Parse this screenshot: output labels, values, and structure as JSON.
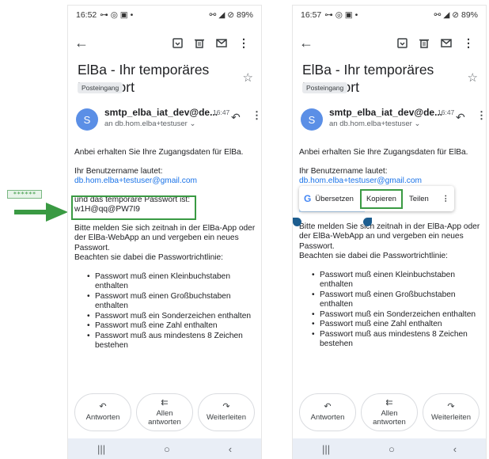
{
  "phones": [
    {
      "status_time": "16:52",
      "status_right": "89%",
      "subject": "ElBa - Ihr temporäres Passwort",
      "label": "Posteingang",
      "avatar_letter": "S",
      "sender": "smtp_elba_iat_dev@de...",
      "time": "16:47",
      "recipient": "an db.hom.elba+testuser ⌄"
    },
    {
      "status_time": "16:57",
      "status_right": "89%",
      "subject": "ElBa - Ihr temporäres Passwort",
      "label": "Posteingang",
      "avatar_letter": "S",
      "sender": "smtp_elba_iat_dev@de...",
      "time": "16:47",
      "recipient": "an db.hom.elba+testuser ⌄"
    }
  ],
  "email": {
    "intro": "Anbei erhalten Sie Ihre Zugangsdaten für ElBa.",
    "username_label": "Ihr Benutzername lautet:",
    "username": "db.hom.elba+testuser@gmail.com",
    "password_label": "und das temporäre Passwort ist:",
    "password": "w1H@qq@PW7I9",
    "instruction": "Bitte melden Sie sich zeitnah in der ElBa-App oder der ElBa-WebApp an und vergeben ein neues Passwort.",
    "rules_intro": "Beachten sie dabei die Passwortrichtlinie:",
    "rules": [
      "Passwort muß einen Kleinbuchstaben enthalten",
      "Passwort muß einen Großbuchstaben enthalten",
      "Passwort muß ein Sonderzeichen enthalten",
      "Passwort muß eine Zahl enthalten",
      "Passwort muß aus mindestens 8 Zeichen bestehen"
    ]
  },
  "actions": {
    "reply": "Antworten",
    "reply_all": "Allen antworten",
    "forward": "Weiterleiten"
  },
  "context_menu": {
    "translate": "Übersetzen",
    "copy": "Kopieren",
    "share": "Teilen"
  },
  "annotation": {
    "masked_password": "******",
    "highlight_color": "#3a9a43"
  },
  "colors": {
    "link": "#1a73e8",
    "avatar": "#5b8fe6",
    "selection": "#bfe0ff"
  }
}
